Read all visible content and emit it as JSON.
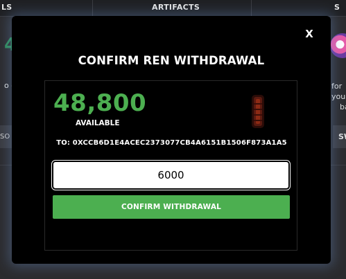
{
  "background": {
    "nav": {
      "left_tab": "LS",
      "center_tab": "ARTIFACTS",
      "right_tab": "S"
    },
    "left_big_value": "4",
    "left_text": "o go",
    "left_button": "SO",
    "right_text_lines": [
      "for",
      "you",
      "ba"
    ],
    "right_button": "SW"
  },
  "modal": {
    "close_label": "X",
    "title": "CONFIRM REN WITHDRAWAL",
    "available_amount": "48,800",
    "available_label": "AVAILABLE",
    "to_address": "TO: 0XCCB6D1E4ACEC2373077CB4A6151B1506F873A1A5",
    "withdraw_value": "6000",
    "confirm_button": "CONFIRM WITHDRAWAL",
    "colors": {
      "accent_green": "#4caf50",
      "modal_bg": "#000000",
      "glow": "#6e96d2"
    },
    "token_icon": "red-capsule-icon"
  }
}
